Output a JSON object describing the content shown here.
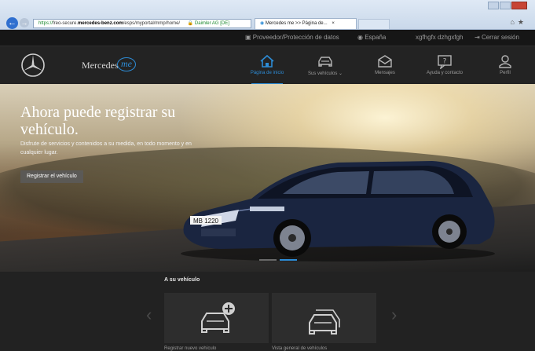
{
  "browser": {
    "url_scheme": "https://",
    "url_before": "freo-secure.",
    "url_domain": "mercedes-benz.com",
    "url_after": "/esps/myportal/mmp/home/",
    "security": "Daimler AG [DE]",
    "tab_title": "Mercedes me >> Página de..."
  },
  "utility_bar": {
    "provider": "Proveedor/Protección de datos",
    "country": "España",
    "user": "xgfhgfx dzhgxfgh",
    "logout": "Cerrar sesión"
  },
  "brand": {
    "name": "Mercedes",
    "me": "me"
  },
  "nav": {
    "items": [
      {
        "label": "Página de inicio",
        "icon": "home-icon"
      },
      {
        "label": "Sus vehículos ⌄",
        "icon": "car-icon"
      },
      {
        "label": "Mensajes",
        "icon": "envelope-icon"
      },
      {
        "label": "Ayuda y contacto",
        "icon": "help-icon"
      },
      {
        "label": "Perfil",
        "icon": "user-icon"
      }
    ]
  },
  "hero": {
    "title": "Ahora puede registrar su vehículo.",
    "description": "Disfrute de servicios y contenidos a su medida, en todo momento y en cualquier lugar.",
    "button": "Registrar el vehículo",
    "plate": "MB 1220"
  },
  "vehicle_section": {
    "title": "A su vehículo",
    "cards": [
      {
        "label": "Registrar nuevo vehículo",
        "icon": "add-car-icon"
      },
      {
        "label": "Vista general de vehículos",
        "icon": "cars-overview-icon"
      }
    ]
  },
  "colors": {
    "accent": "#2d8cd6",
    "nav_bg": "#232323",
    "section_bg": "#222222"
  }
}
